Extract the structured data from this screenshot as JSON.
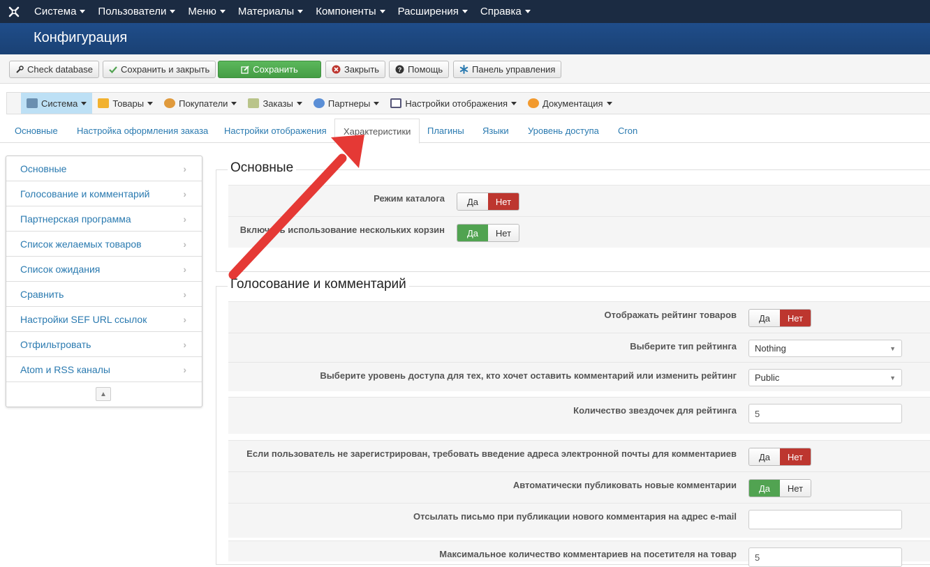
{
  "topnav": {
    "items": [
      "Система",
      "Пользователи",
      "Меню",
      "Материалы",
      "Компоненты",
      "Расширения",
      "Справка"
    ]
  },
  "header": {
    "title": "Конфигурация"
  },
  "toolbar": {
    "check_db": "Check database",
    "save_close": "Сохранить и закрыть",
    "save": "Сохранить",
    "close": "Закрыть",
    "help": "Помощь",
    "control_panel": "Панель управления"
  },
  "submenu": {
    "items": [
      "Система",
      "Товары",
      "Покупатели",
      "Заказы",
      "Партнеры",
      "Настройки отображения",
      "Документация"
    ]
  },
  "tabs": [
    "Основные",
    "Настройка оформления заказа",
    "Настройки отображения",
    "Характеристики",
    "Плагины",
    "Языки",
    "Уровень доступа",
    "Cron"
  ],
  "sidenav": {
    "items": [
      "Основные",
      "Голосование и комментарий",
      "Партнерская программа",
      "Список желаемых товаров",
      "Список ожидания",
      "Сравнить",
      "Настройки SEF URL ссылок",
      "Отфильтровать",
      "Atom и RSS каналы"
    ]
  },
  "toggle": {
    "yes": "Да",
    "no": "Нет"
  },
  "section1": {
    "legend": "Основные",
    "catalog_mode": "Режим каталога",
    "multi_cart": "Включить использование нескольких корзин"
  },
  "section2": {
    "legend": "Голосование и комментарий",
    "show_rating": "Отображать рейтинг товаров",
    "rating_type": "Выберите тип рейтинга",
    "rating_type_value": "Nothing",
    "access_level": "Выберите уровень доступа для тех, кто хочет оставить комментарий или изменить рейтинг",
    "access_level_value": "Public",
    "stars_count": "Количество звездочек для рейтинга",
    "stars_count_value": "5",
    "require_email": "Если пользователь не зарегистрирован, требовать введение адреса электронной почты для комментариев",
    "auto_publish": "Автоматически публиковать новые комментарии",
    "notify_email": "Отсылать письмо при публикации нового комментария на адрес e-mail",
    "notify_email_value": "",
    "max_comments": "Максимальное количество комментариев на посетителя на товар",
    "max_comments_value": "5"
  },
  "colors": {
    "accent": "#e53935",
    "nav": "#1b2b42",
    "header": "#1f4d8a",
    "green": "#51a351",
    "red": "#bd362f"
  }
}
